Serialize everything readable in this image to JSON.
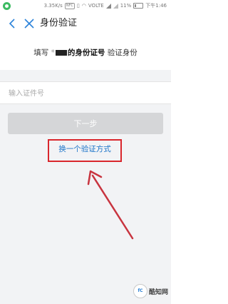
{
  "status_bar": {
    "speed": "3.35K/s",
    "nfc": "NFC",
    "volte": "VOLTE",
    "battery": "11%",
    "time": "下午1:46"
  },
  "header": {
    "title": "身份验证"
  },
  "prompt": {
    "prefix": "填写",
    "masked_prefix": "*",
    "bold_text": "的身份证号",
    "suffix": "验证身份"
  },
  "form": {
    "id_placeholder": "输入证件号",
    "id_value": "",
    "next_label": "下一步"
  },
  "switch_link": {
    "label": "换一个验证方式"
  },
  "annotation": {
    "highlight_color": "#d9262c"
  },
  "watermark": {
    "logo_text": "fC",
    "text": "酷知网"
  }
}
